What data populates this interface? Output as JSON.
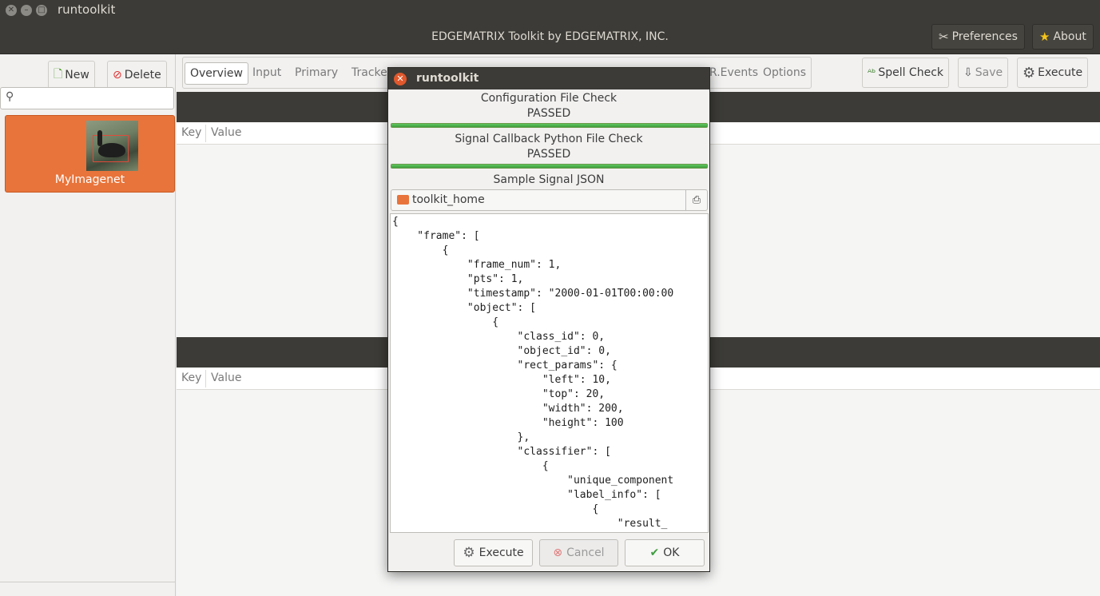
{
  "window": {
    "title": "runtoolkit"
  },
  "header": {
    "title": "EDGEMATRIX Toolkit by EDGEMATRIX, INC.",
    "preferences_label": "Preferences",
    "about_label": "About"
  },
  "left_toolbar": {
    "new_label": "New",
    "delete_label": "Delete"
  },
  "search": {
    "placeholder": ""
  },
  "apps": [
    {
      "label": "MyImagenet"
    }
  ],
  "tabs": [
    {
      "label": "Overview"
    },
    {
      "label": "Input"
    },
    {
      "label": "Primary"
    },
    {
      "label": "Tracke"
    },
    {
      "label": "R.Events"
    },
    {
      "label": "Options"
    }
  ],
  "right_toolbar": {
    "spell_label": "Spell Check",
    "save_label": "Save",
    "execute_label": "Execute"
  },
  "table_top": {
    "key_header": "Key",
    "value_header": "Value"
  },
  "table_bottom": {
    "key_header": "Key",
    "value_header": "Value"
  },
  "dialog": {
    "title": "runtoolkit",
    "config_check": {
      "label": "Configuration File Check",
      "status": "PASSED",
      "progress": 1.0
    },
    "signal_check": {
      "label": "Signal Callback Python File Check",
      "status": "PASSED",
      "progress": 1.0
    },
    "sample_label": "Sample Signal JSON",
    "path": "toolkit_home",
    "json_text": "{\n    \"frame\": [\n        {\n            \"frame_num\": 1,\n            \"pts\": 1,\n            \"timestamp\": \"2000-01-01T00:00:00\n            \"object\": [\n                {\n                    \"class_id\": 0,\n                    \"object_id\": 0,\n                    \"rect_params\": {\n                        \"left\": 10,\n                        \"top\": 20,\n                        \"width\": 200,\n                        \"height\": 100\n                    },\n                    \"classifier\": [\n                        {\n                            \"unique_component\n                            \"label_info\": [\n                                {\n                                    \"result_",
    "execute_label": "Execute",
    "cancel_label": "Cancel",
    "ok_label": "OK"
  },
  "colors": {
    "accent": "#e8743b",
    "dark": "#3c3b37",
    "progress": "#4caf50"
  }
}
